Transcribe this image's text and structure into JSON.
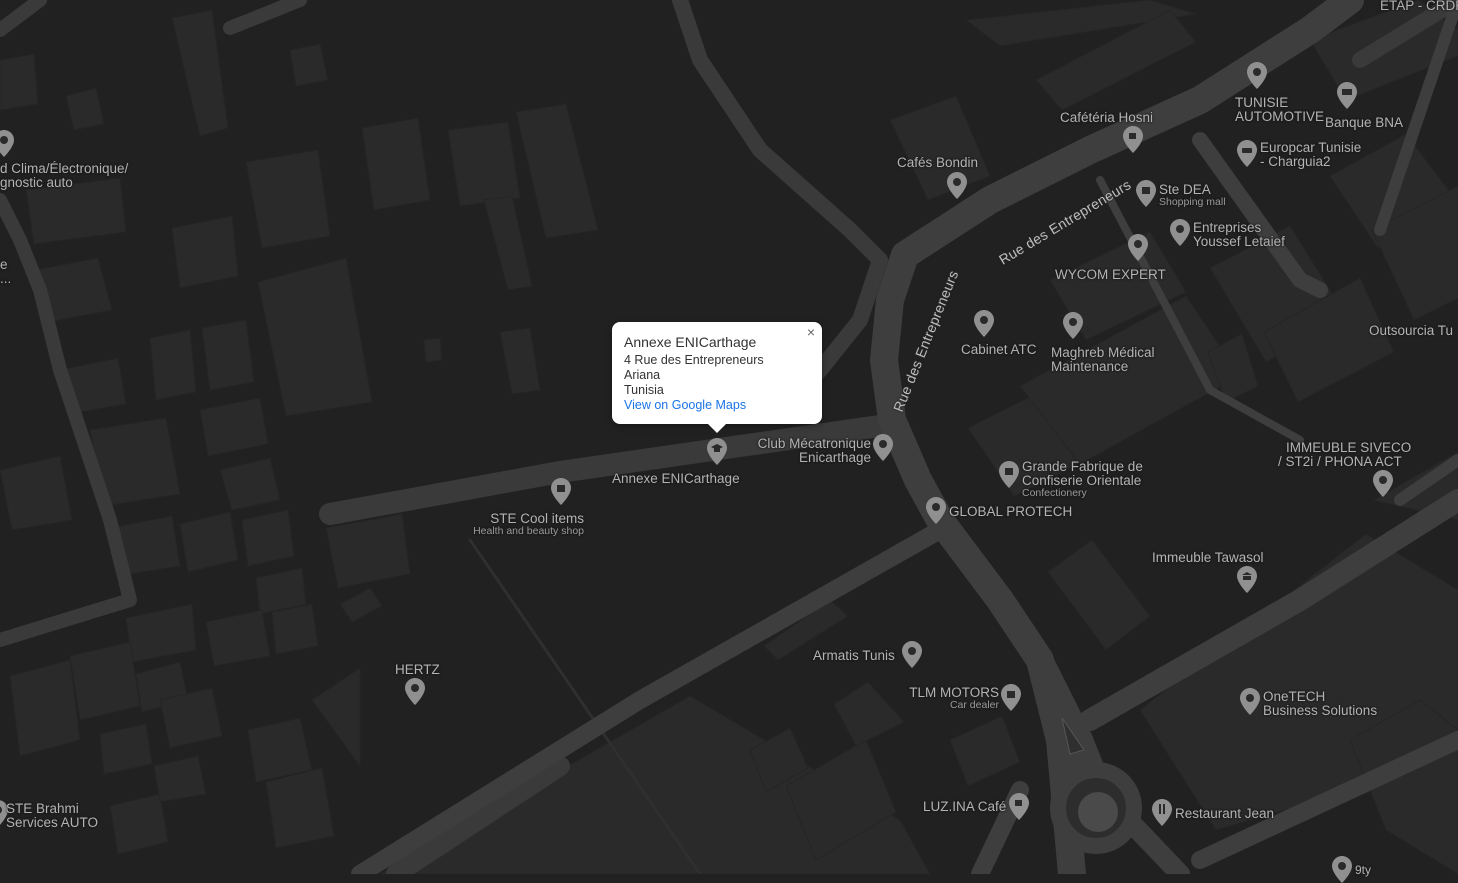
{
  "info_window": {
    "title": "Annexe ENICarthage",
    "address_line1": "4 Rue des Entrepreneurs",
    "address_line2": "Ariana",
    "address_line3": "Tunisia",
    "link": "View on Google Maps",
    "close": "×"
  },
  "roads": {
    "rue_entrepreneurs_1": "Rue des Entrepreneurs",
    "rue_entrepreneurs_2": "Rue des Entrepreneurs"
  },
  "places": {
    "etap": "ETAP - CRDP",
    "tunisie_automotive_1": "TUNISIE",
    "tunisie_automotive_2": "AUTOMOTIVE",
    "banque_bna": "Banque BNA",
    "cafeteria_hosni": "Cafétéria Hosni",
    "europcar_1": "Europcar Tunisie",
    "europcar_2": "- Charguia2",
    "cafes_bondin": "Cafés Bondin",
    "ste_dea": "Ste DEA",
    "ste_dea_sub": "Shopping mall",
    "entreprises_1": "Entreprises",
    "entreprises_2": "Youssef Letaief",
    "wycom": "WYCOM EXPERT",
    "clima_1": "d Clima/Électronique/",
    "clima_2": "gnostic auto",
    "left_cut_1": "e",
    "left_cut_2": "...",
    "outsourcia": "Outsourcia Tu",
    "cabinet_atc": "Cabinet ATC",
    "maghreb_1": "Maghreb Médical",
    "maghreb_2": "Maintenance",
    "club_1": "Club Mécatronique",
    "club_2": "Enicarthage",
    "annexe": "Annexe ENICarthage",
    "immeuble_siveco_1": "IMMEUBLE SIVECO",
    "immeuble_siveco_2": "/ ST2i / PHONA ACT",
    "grande_fabrique_1": "Grande Fabrique de",
    "grande_fabrique_2": "Confiserie Orientale",
    "grande_fabrique_sub": "Confectionery",
    "ste_cool": "STE Cool items",
    "ste_cool_sub": "Health and beauty shop",
    "global_protech": "GLOBAL PROTECH",
    "immeuble_tawasol": "Immeuble Tawasol",
    "armatis": "Armatis Tunis",
    "hertz": "HERTZ",
    "tlm_motors": "TLM MOTORS",
    "tlm_motors_sub": "Car dealer",
    "onetech_1": "OneTECH",
    "onetech_2": "Business Solutions",
    "luzina": "LUZ.INA Café",
    "restaurant_jean": "Restaurant Jean",
    "ste_brahmi_1": "STE Brahmi",
    "ste_brahmi_2": "Services AUTO",
    "qty": "9ty"
  },
  "colors": {
    "background": "#212121",
    "road": "#3a3a3a",
    "building": "#2a2a2a",
    "pin": "#909090",
    "label": "#b3b3b3",
    "link": "#1a73e8"
  }
}
